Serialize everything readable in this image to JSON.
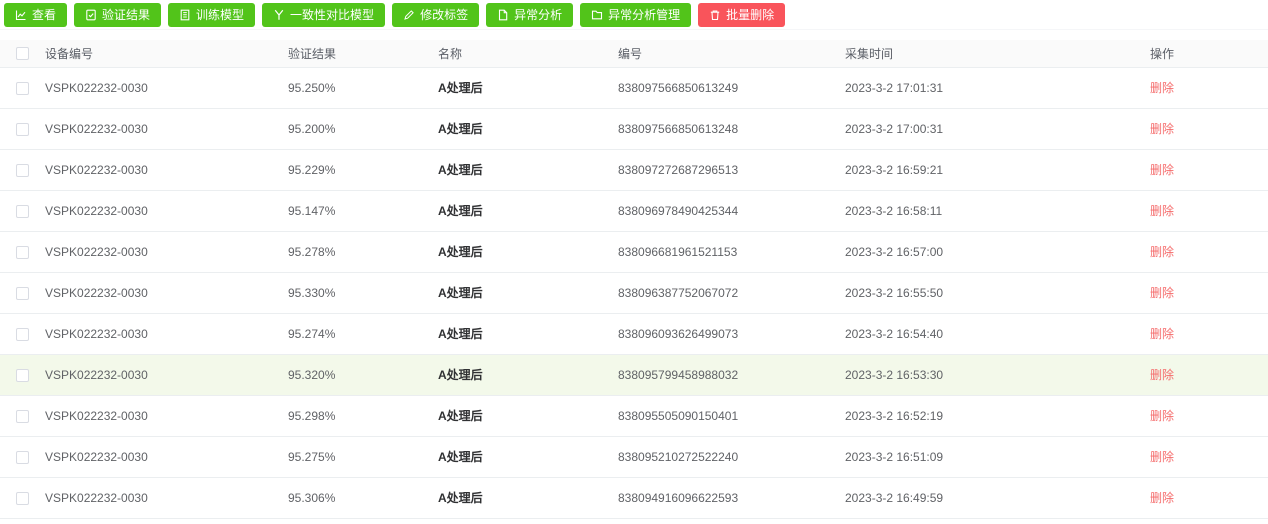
{
  "toolbar": {
    "buttons": [
      {
        "label": "查看",
        "icon": "chart-line",
        "type": "green"
      },
      {
        "label": "验证结果",
        "icon": "report",
        "type": "green"
      },
      {
        "label": "训练模型",
        "icon": "notebook",
        "type": "green"
      },
      {
        "label": "一致性对比模型",
        "icon": "branch-y",
        "type": "green"
      },
      {
        "label": "修改标签",
        "icon": "pen",
        "type": "green"
      },
      {
        "label": "异常分析",
        "icon": "file",
        "type": "green"
      },
      {
        "label": "异常分析管理",
        "icon": "folder",
        "type": "green"
      },
      {
        "label": "批量删除",
        "icon": "trash",
        "type": "red"
      }
    ]
  },
  "table": {
    "columns": [
      "设备编号",
      "验证结果",
      "名称",
      "编号",
      "采集时间",
      "操作"
    ],
    "delete_label": "删除",
    "rows": [
      {
        "device": "VSPK022232-0030",
        "result": "95.250%",
        "name": "A处理后",
        "number": "838097566850613249",
        "time": "2023-3-2 17:01:31",
        "highlighted": false
      },
      {
        "device": "VSPK022232-0030",
        "result": "95.200%",
        "name": "A处理后",
        "number": "838097566850613248",
        "time": "2023-3-2 17:00:31",
        "highlighted": false
      },
      {
        "device": "VSPK022232-0030",
        "result": "95.229%",
        "name": "A处理后",
        "number": "838097272687296513",
        "time": "2023-3-2 16:59:21",
        "highlighted": false
      },
      {
        "device": "VSPK022232-0030",
        "result": "95.147%",
        "name": "A处理后",
        "number": "838096978490425344",
        "time": "2023-3-2 16:58:11",
        "highlighted": false
      },
      {
        "device": "VSPK022232-0030",
        "result": "95.278%",
        "name": "A处理后",
        "number": "838096681961521153",
        "time": "2023-3-2 16:57:00",
        "highlighted": false
      },
      {
        "device": "VSPK022232-0030",
        "result": "95.330%",
        "name": "A处理后",
        "number": "838096387752067072",
        "time": "2023-3-2 16:55:50",
        "highlighted": false
      },
      {
        "device": "VSPK022232-0030",
        "result": "95.274%",
        "name": "A处理后",
        "number": "838096093626499073",
        "time": "2023-3-2 16:54:40",
        "highlighted": false
      },
      {
        "device": "VSPK022232-0030",
        "result": "95.320%",
        "name": "A处理后",
        "number": "838095799458988032",
        "time": "2023-3-2 16:53:30",
        "highlighted": true
      },
      {
        "device": "VSPK022232-0030",
        "result": "95.298%",
        "name": "A处理后",
        "number": "838095505090150401",
        "time": "2023-3-2 16:52:19",
        "highlighted": false
      },
      {
        "device": "VSPK022232-0030",
        "result": "95.275%",
        "name": "A处理后",
        "number": "838095210272522240",
        "time": "2023-3-2 16:51:09",
        "highlighted": false
      },
      {
        "device": "VSPK022232-0030",
        "result": "95.306%",
        "name": "A处理后",
        "number": "838094916096622593",
        "time": "2023-3-2 16:49:59",
        "highlighted": false
      }
    ]
  },
  "colors": {
    "button_green": "#52c41a",
    "button_red": "#f9545b",
    "delete_link": "#f56c6c",
    "row_highlight": "#f3f9ea"
  }
}
